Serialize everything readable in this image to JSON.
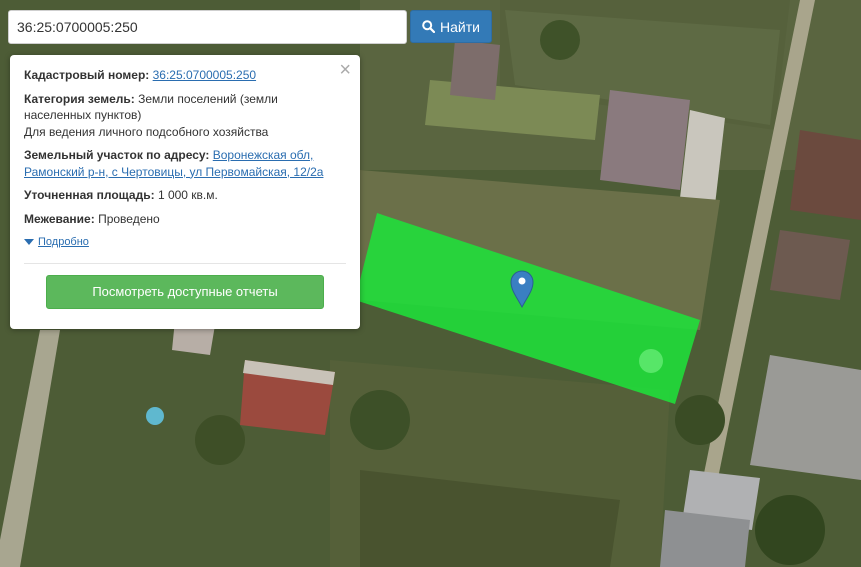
{
  "search": {
    "value": "36:25:0700005:250",
    "button_label": "Найти"
  },
  "map": {
    "parcel_color": "#1fe03a",
    "marker_color": "#3a7fc2"
  },
  "popup": {
    "cadastral_label": "Кадастровый номер:",
    "cadastral_value": "36:25:0700005:250",
    "category_label": "Категория земель:",
    "category_value": "Земли поселений (земли населенных пунктов)",
    "category_use": "Для ведения личного подсобного хозяйства",
    "address_label": "Земельный участок по адресу:",
    "address_value": "Воронежская обл, Рамонский р-н, с Чертовицы, ул Первомайская, 12/2а",
    "area_label": "Уточненная площадь:",
    "area_value": "1 000 кв.м.",
    "survey_label": "Межевание:",
    "survey_value": "Проведено",
    "more_link": "Подробно",
    "report_button": "Посмотреть доступные отчеты",
    "close_symbol": "×"
  }
}
